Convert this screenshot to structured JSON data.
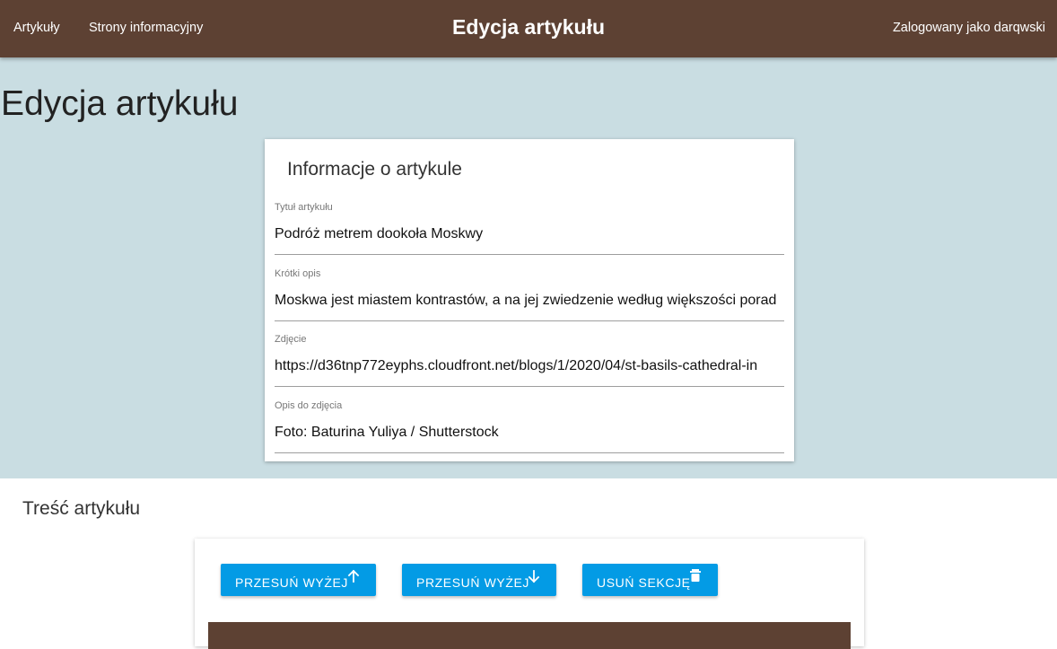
{
  "nav": {
    "articles": "Artykuły",
    "pages": "Strony informacyjny",
    "title": "Edycja artykułu",
    "user": "Zalogowany jako darqwski"
  },
  "page": {
    "title": "Edycja artykułu"
  },
  "info_card": {
    "title": "Informacje o artykule",
    "fields": [
      {
        "label": "Tytuł artykułu",
        "value": "Podróż metrem dookoła Moskwy"
      },
      {
        "label": "Krótki opis",
        "value": "Moskwa jest miastem kontrastów, a na jej zwiedzenie według większości porad"
      },
      {
        "label": "Zdjęcie",
        "value": "https://d36tnp772eyphs.cloudfront.net/blogs/1/2020/04/st-basils-cathedral-in"
      },
      {
        "label": "Opis do zdjęcia",
        "value": "Foto: Baturina Yuliya / Shutterstock"
      }
    ]
  },
  "content": {
    "heading": "Treść artykułu",
    "buttons": {
      "move_up": "PRZESUŃ WYŻEJ",
      "move_down": "PRZESUŃ WYŻEJ",
      "delete": "USUŃ SEKCJĘ"
    },
    "icons": {
      "move_up": "arrow-up-icon",
      "move_down": "arrow-down-icon",
      "delete": "trash-icon"
    }
  },
  "colors": {
    "header_bg": "#5d4133",
    "upper_bg": "#c9dde2",
    "button_bg": "#039be5"
  }
}
